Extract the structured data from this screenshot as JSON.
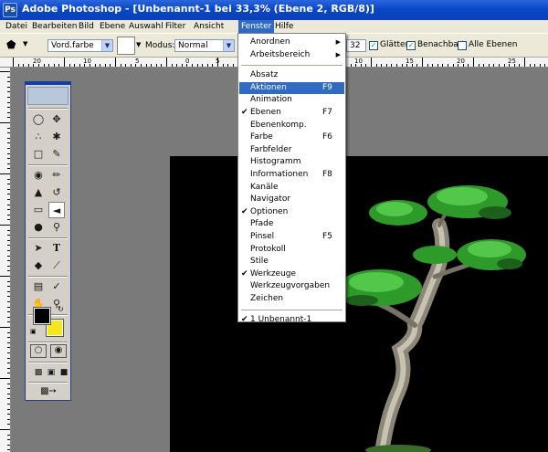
{
  "window": {
    "title": "Adobe Photoshop - [Unbenannt-1 bei 33,3% (Ebene 2, RGB/8)]"
  },
  "menubar": [
    {
      "label": "Datei"
    },
    {
      "label": "Bearbeiten"
    },
    {
      "label": "Bild"
    },
    {
      "label": "Ebene"
    },
    {
      "label": "Auswahl"
    },
    {
      "label": "Filter"
    },
    {
      "label": "Ansicht"
    },
    {
      "label": "Fenster"
    },
    {
      "label": "Hilfe"
    }
  ],
  "options": {
    "preset": "Vord.farbe",
    "mode_label": "Modus:",
    "mode_value": "Normal",
    "tolerance_value": "32",
    "antialias_label": "Glätten",
    "antialias_checked": true,
    "contiguous_label": "Benachbart",
    "contiguous_checked": true,
    "all_layers_label": "Alle Ebenen",
    "all_layers_checked": false
  },
  "ruler": {
    "labels": [
      "20",
      "10",
      "5",
      "0",
      "5",
      "10",
      "15",
      "20",
      "25"
    ]
  },
  "fenster_menu": {
    "items": [
      {
        "label": "Anordnen",
        "submenu": true
      },
      {
        "label": "Arbeitsbereich",
        "submenu": true
      },
      {
        "separator": true
      },
      {
        "label": "Absatz"
      },
      {
        "label": "Aktionen",
        "shortcut": "F9",
        "highlighted": true
      },
      {
        "label": "Animation"
      },
      {
        "label": "Ebenen",
        "shortcut": "F7",
        "checked": true
      },
      {
        "label": "Ebenenkomp."
      },
      {
        "label": "Farbe",
        "shortcut": "F6"
      },
      {
        "label": "Farbfelder"
      },
      {
        "label": "Histogramm"
      },
      {
        "label": "Informationen",
        "shortcut": "F8"
      },
      {
        "label": "Kanäle"
      },
      {
        "label": "Navigator"
      },
      {
        "label": "Optionen",
        "checked": true
      },
      {
        "label": "Pfade"
      },
      {
        "label": "Pinsel",
        "shortcut": "F5"
      },
      {
        "label": "Protokoll"
      },
      {
        "label": "Stile"
      },
      {
        "label": "Werkzeuge",
        "checked": true
      },
      {
        "label": "Werkzeugvorgaben"
      },
      {
        "label": "Zeichen"
      },
      {
        "separator": true
      },
      {
        "label": "1 Unbenannt-1",
        "checked": true
      }
    ]
  },
  "toolbox": {
    "tools": [
      "marquee-icon",
      "move-icon",
      "lasso-icon",
      "magic-wand-icon",
      "crop-icon",
      "slice-icon",
      "healing-brush-icon",
      "brush-icon",
      "clone-stamp-icon",
      "history-brush-icon",
      "eraser-icon",
      "paint-bucket-icon",
      "blur-icon",
      "dodge-icon",
      "path-select-icon",
      "type-icon",
      "pen-icon",
      "line-icon",
      "notes-icon",
      "eyedropper-icon",
      "hand-icon",
      "zoom-icon"
    ],
    "foreground_color": "#000000",
    "background_color": "#f7e51d"
  },
  "colors": {
    "accent": "#316ac5",
    "title_bar": "#0a47c8",
    "canvas": "#000000"
  }
}
